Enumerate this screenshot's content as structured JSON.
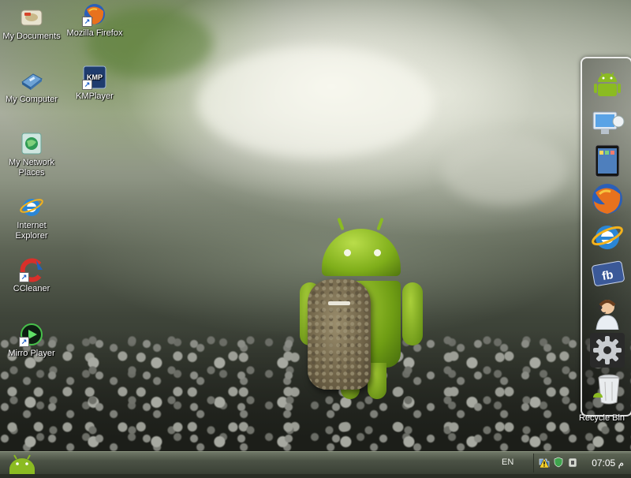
{
  "desktop": {
    "icons": [
      {
        "label": "My Documents",
        "icon": "my-documents-icon"
      },
      {
        "label": "Mozilla Firefox",
        "icon": "firefox-icon"
      },
      {
        "label": "My Computer",
        "icon": "my-computer-icon"
      },
      {
        "label": "KMPlayer",
        "icon": "kmplayer-icon",
        "badge": "KMP"
      },
      {
        "label": "My Network Places",
        "icon": "network-places-icon"
      },
      {
        "label": "Internet Explorer",
        "icon": "internet-explorer-icon"
      },
      {
        "label": "CCleaner",
        "icon": "ccleaner-icon"
      },
      {
        "label": "Mirro Player",
        "icon": "mirro-player-icon"
      }
    ],
    "shortcut_arrow": "↗"
  },
  "dock": {
    "items": [
      {
        "icon": "android-icon"
      },
      {
        "icon": "computer-monitor-icon"
      },
      {
        "icon": "tablet-icon"
      },
      {
        "icon": "firefox-icon"
      },
      {
        "icon": "internet-explorer-icon"
      },
      {
        "icon": "facebook-icon",
        "text": "fb"
      },
      {
        "icon": "support-agent-icon"
      },
      {
        "icon": "settings-gear-icon"
      },
      {
        "icon": "recycle-bin-icon"
      }
    ],
    "recycle_bin_label": "Recycle Bin"
  },
  "taskbar": {
    "start_icon": "android-start-icon",
    "language": "EN",
    "tray_icons": [
      "network-icon",
      "warning-icon",
      "shield-icon",
      "volume-icon"
    ],
    "clock": "07:05 م"
  },
  "colors": {
    "android_green": "#8bbb22",
    "taskbar_dark": "#3a4035",
    "dock_border": "#ffffff"
  }
}
